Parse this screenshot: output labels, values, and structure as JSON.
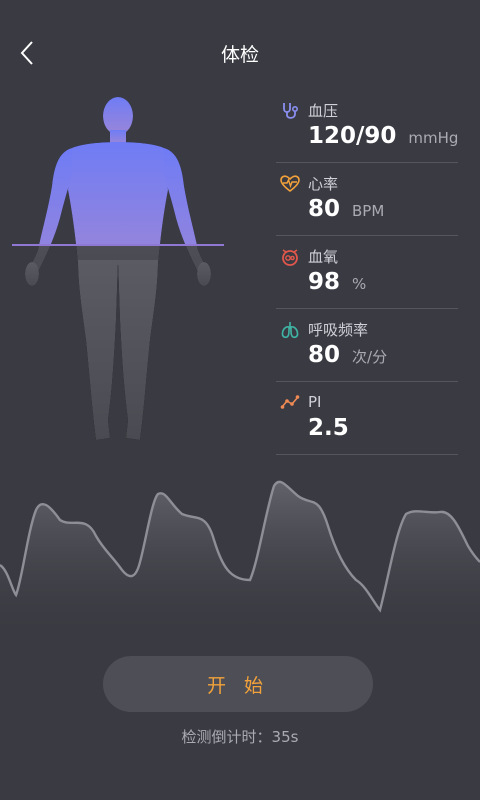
{
  "header": {
    "title": "体检"
  },
  "metrics": [
    {
      "label": "血压",
      "value": "120/90",
      "unit": "mmHg",
      "icon": "stethoscope-icon",
      "color": "#8a8ff0"
    },
    {
      "label": "心率",
      "value": "80",
      "unit": "BPM",
      "icon": "heart-rate-icon",
      "color": "#f3a23b"
    },
    {
      "label": "血氧",
      "value": "98",
      "unit": "%",
      "icon": "blood-oxygen-icon",
      "color": "#e2574c"
    },
    {
      "label": "呼吸频率",
      "value": "80",
      "unit": "次/分",
      "icon": "lungs-icon",
      "color": "#3fb5a5"
    },
    {
      "label": "PI",
      "value": "2.5",
      "unit": "",
      "icon": "pi-chart-icon",
      "color": "#f08a55"
    }
  ],
  "actions": {
    "start_label": "开 始"
  },
  "status": {
    "countdown": "检测倒计时：35s"
  }
}
